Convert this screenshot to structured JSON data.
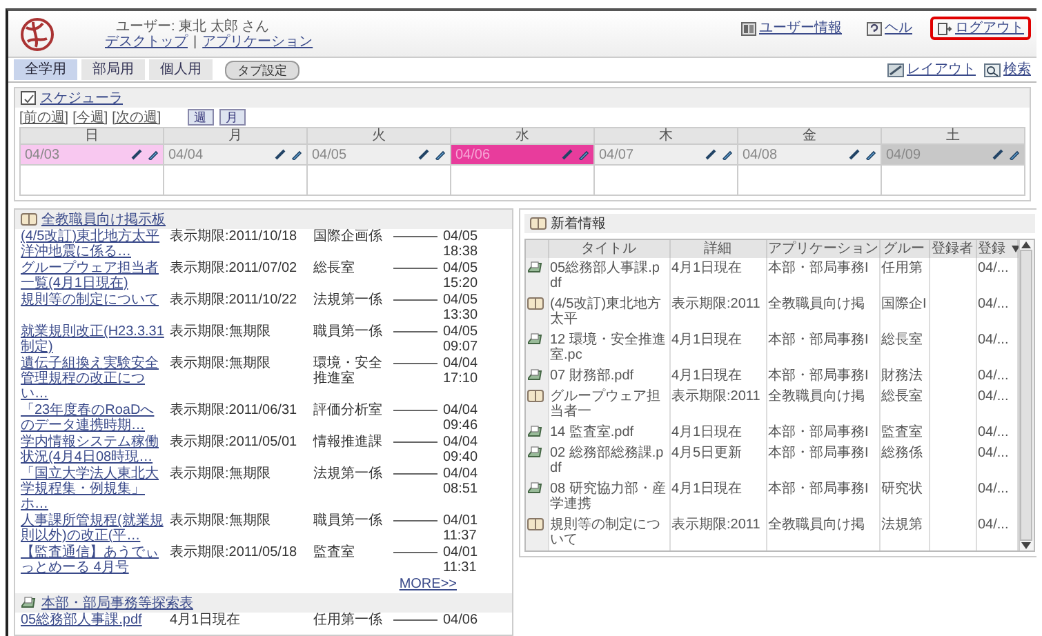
{
  "header": {
    "user": "ユーザー: 東北 太郎 さん",
    "nav": {
      "items": [
        "デスクトップ",
        "アプリケーション"
      ],
      "separator": "|"
    },
    "links": [
      {
        "label": "ユーザー情報",
        "kind": "info",
        "highlighted": false
      },
      {
        "label": "ヘル",
        "kind": "help",
        "highlighted": false
      },
      {
        "label": "ログアウト",
        "kind": "logout",
        "highlighted": true
      }
    ]
  },
  "tabs": [
    {
      "label": "全学用",
      "selected": true
    },
    {
      "label": "部局用",
      "selected": false
    },
    {
      "label": "個人用",
      "selected": false
    }
  ],
  "tab_settings": "タブ設定",
  "tools": [
    {
      "label": "レイアウト",
      "kind": "layout"
    },
    {
      "label": "検索",
      "kind": "search"
    }
  ],
  "schedule": {
    "title": "スケジューラ",
    "week_links": [
      "[前の週]",
      "[今週]",
      "[次の週]"
    ],
    "views": [
      "週",
      "月"
    ],
    "days": [
      {
        "name": "日",
        "date": "04/03",
        "color": "#f8c8f0"
      },
      {
        "name": "月",
        "date": "04/04",
        "color": "#eeeeee"
      },
      {
        "name": "火",
        "date": "04/05",
        "color": "#eeeeee"
      },
      {
        "name": "水",
        "date": "04/06",
        "color": "#e83c9c"
      },
      {
        "name": "木",
        "date": "04/07",
        "color": "#eeeeee"
      },
      {
        "name": "金",
        "date": "04/08",
        "color": "#eeeeee"
      },
      {
        "name": "土",
        "date": "04/09",
        "color": "#c8c8c8"
      }
    ]
  },
  "board": {
    "title": "全教職員向け掲示板",
    "more": "MORE>>",
    "posts": [
      {
        "title": "(4/5改訂)東北地方太平洋沖地震に係る…",
        "period": "表示期限:2011/10/18",
        "dept": "国際企画係",
        "date": "04/05",
        "time": "18:38"
      },
      {
        "title": "グループウェア担当者一覧(4月1日現在)",
        "period": "表示期限:2011/07/02",
        "dept": "総長室",
        "date": "04/05",
        "time": "15:20"
      },
      {
        "title": "規則等の制定について",
        "period": "表示期限:2011/10/22",
        "dept": "法規第一係",
        "date": "04/05",
        "time": "13:30"
      },
      {
        "title": "就業規則改正(H23.3.31制定)",
        "period": "表示期限:無期限",
        "dept": "職員第一係",
        "date": "04/05",
        "time": "09:07"
      },
      {
        "title": "遺伝子組換え実験安全管理規程の改正につい…",
        "period": "表示期限:無期限",
        "dept": "環境・安全推進室",
        "date": "04/04",
        "time": "17:10"
      },
      {
        "title": "「23年度春のRoaDへのデータ連携時期…",
        "period": "表示期限:2011/06/31",
        "dept": "評価分析室",
        "date": "04/04",
        "time": "09:46"
      },
      {
        "title": "学内情報システム稼働状況(4月4日08時現…",
        "period": "表示期限:2011/05/01",
        "dept": "情報推進課",
        "date": "04/04",
        "time": "09:40"
      },
      {
        "title": "「国立大学法人東北大学規程集・例規集」ホ…",
        "period": "表示期限:無期限",
        "dept": "法規第一係",
        "date": "04/04",
        "time": "08:51"
      },
      {
        "title": "人事課所管規程(就業規則以外)の改正(平…",
        "period": "表示期限:無期限",
        "dept": "職員第一係",
        "date": "04/01",
        "time": "11:37"
      },
      {
        "title": "【監査通信】あうでぃっとめーる 4月号",
        "period": "表示期限:2011/05/18",
        "dept": "監査室",
        "date": "04/01",
        "time": "11:31"
      }
    ]
  },
  "board2": {
    "title": "本部・部局事務等探索表",
    "posts": [
      {
        "title": "05総務部人事課.pdf",
        "period": "4月1日現在",
        "dept": "任用第一係",
        "date": "04/06"
      }
    ]
  },
  "news": {
    "title": "新着情報",
    "columns": [
      "タイトル",
      "詳細",
      "アプリケーション",
      "グルー",
      "登録者",
      "登録"
    ],
    "rows": [
      {
        "kind": "file",
        "title": "05総務部人事課.pdf",
        "detail": "4月1日現在",
        "app": "本部・部局事務I",
        "group": "任用第",
        "date": "04/..."
      },
      {
        "kind": "board",
        "title": "(4/5改訂)東北地方太平",
        "detail": "表示期限:2011",
        "app": "全教職員向け掲",
        "group": "国際企I",
        "date": "04/..."
      },
      {
        "kind": "file",
        "title": "12 環境・安全推進室.pc",
        "detail": "4月1日現在",
        "app": "本部・部局事務I",
        "group": "総長室",
        "date": "04/..."
      },
      {
        "kind": "file",
        "title": "07 財務部.pdf",
        "detail": "4月1日現在",
        "app": "本部・部局事務I",
        "group": "財務法",
        "date": "04/..."
      },
      {
        "kind": "board",
        "title": "グループウェア担当者一",
        "detail": "表示期限:2011",
        "app": "全教職員向け掲",
        "group": "総長室",
        "date": "04/..."
      },
      {
        "kind": "file",
        "title": "14 監査室.pdf",
        "detail": "4月1日現在",
        "app": "本部・部局事務I",
        "group": "監査室",
        "date": "04/..."
      },
      {
        "kind": "file",
        "title": "02 総務部総務課.pdf",
        "detail": "4月5日更新",
        "app": "本部・部局事務I",
        "group": "総務係",
        "date": "04/..."
      },
      {
        "kind": "file",
        "title": "08 研究協力部・産学連携",
        "detail": "4月1日現在",
        "app": "本部・部局事務I",
        "group": "研究状",
        "date": "04/..."
      },
      {
        "kind": "board",
        "title": "規則等の制定について",
        "detail": "表示期限:2011",
        "app": "全教職員向け掲",
        "group": "法規第",
        "date": "04/..."
      }
    ]
  }
}
